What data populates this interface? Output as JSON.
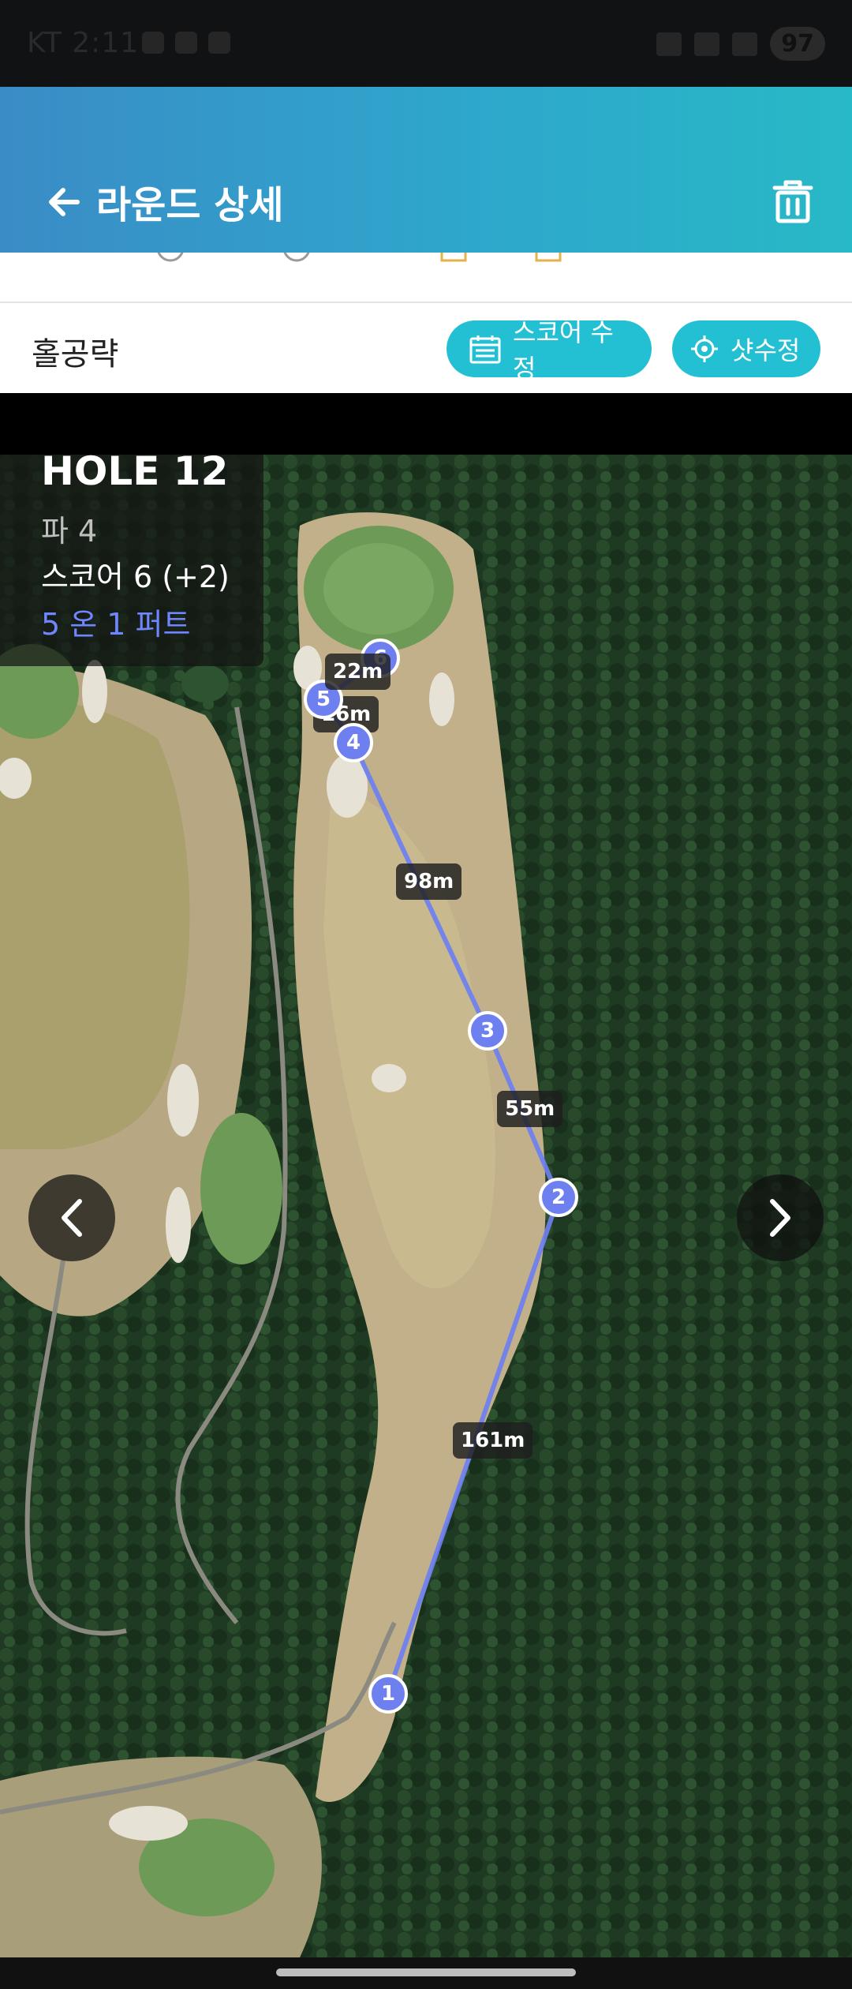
{
  "status_bar": {
    "time": "KT 2:11",
    "battery": "97"
  },
  "header": {
    "title": "라운드 상세",
    "back_icon": "arrow-left-icon",
    "trash_icon": "trash-icon"
  },
  "section": {
    "title": "홀공략",
    "score_button": "스코어 수정",
    "shot_button": "샷수정"
  },
  "hole_info": {
    "hole": "HOLE 12",
    "par": "파 4",
    "score": "스코어 6 (+2)",
    "putts": "5 온 1 퍼트"
  },
  "shots": [
    {
      "number": "1"
    },
    {
      "number": "2"
    },
    {
      "number": "3"
    },
    {
      "number": "4"
    },
    {
      "number": "5"
    },
    {
      "number": "6"
    }
  ],
  "distances": [
    "161m",
    "55m",
    "98m",
    "16m",
    "22m"
  ],
  "colors": {
    "accent": "#23c0d4",
    "shot_marker": "#6e7ff0",
    "putt_text": "#6f86ff"
  }
}
